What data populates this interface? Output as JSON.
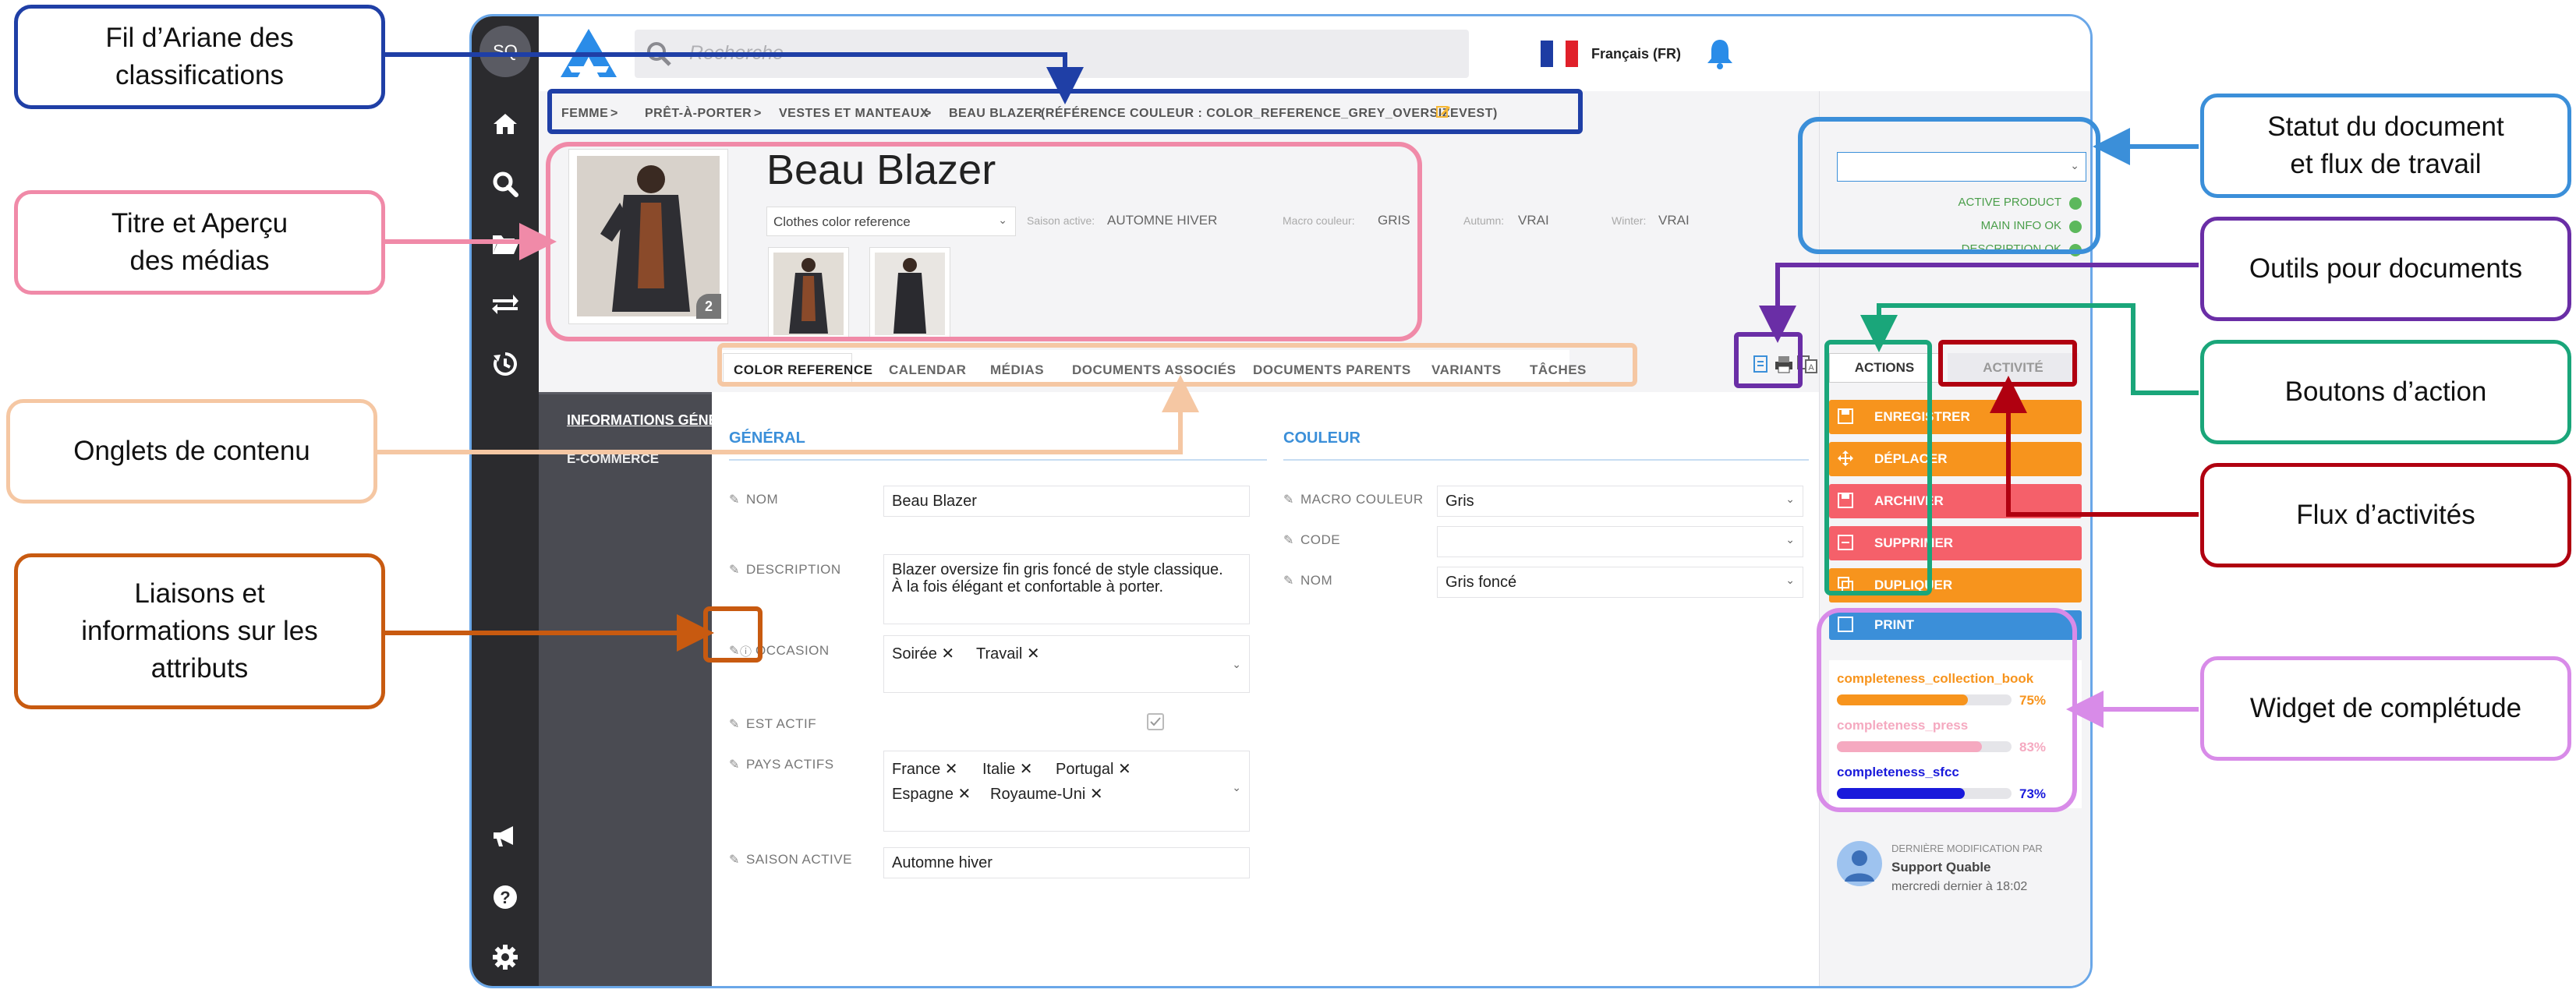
{
  "app": {
    "user_initials": "SQ",
    "search_placeholder": "Recherche",
    "language": "Français (FR)"
  },
  "breadcrumb": [
    "FEMME",
    "PRÊT-À-PORTER",
    "VESTES ET MANTEAUX",
    "BEAU BLAZER",
    "(RÉFÉRENCE COULEUR : COLOR_REFERENCE_GREY_OVERSIZEVEST)"
  ],
  "breadcrumb_sep": ">",
  "header": {
    "title": "Beau Blazer",
    "type_select": "Clothes color reference",
    "media_count": "2",
    "meta": [
      {
        "label": "Saison active:",
        "value": "AUTOMNE HIVER"
      },
      {
        "label": "Macro couleur:",
        "value": "GRIS"
      },
      {
        "label": "Autumn:",
        "value": "VRAI"
      },
      {
        "label": "Winter:",
        "value": "VRAI"
      }
    ]
  },
  "tabs": [
    "COLOR REFERENCE",
    "CALENDAR",
    "MÉDIAS",
    "DOCUMENTS ASSOCIÉS",
    "DOCUMENTS PARENTS",
    "VARIANTS",
    "TÂCHES"
  ],
  "left_nav": [
    "INFORMATIONS GÉNÉ",
    "E-COMMERCE"
  ],
  "general": {
    "heading": "GÉNÉRAL",
    "nom_label": "NOM",
    "nom_value": "Beau Blazer",
    "description_label": "DESCRIPTION",
    "description_value_1": "Blazer oversize fin gris foncé de style classique.",
    "description_value_2": "À la fois élégant et confortable à porter.",
    "occasion_label": "OCCASION",
    "occasion_values": [
      "Soirée",
      "Travail"
    ],
    "est_actif_label": "EST ACTIF",
    "pays_label": "PAYS ACTIFS",
    "pays_values": [
      "France",
      "Italie",
      "Portugal",
      "Espagne",
      "Royaume-Uni"
    ],
    "saison_label": "SAISON ACTIVE",
    "saison_value": "Automne hiver"
  },
  "couleur": {
    "heading": "COULEUR",
    "macro_label": "MACRO COULEUR",
    "macro_value": "Gris",
    "code_label": "CODE",
    "code_value": "",
    "nom_label": "NOM",
    "nom_value": "Gris foncé"
  },
  "status": [
    "ACTIVE PRODUCT",
    "MAIN INFO OK",
    "DESCRIPTION OK"
  ],
  "right_tabs": [
    "ACTIONS",
    "ACTIVITÉ"
  ],
  "actions": [
    {
      "label": "ENREGISTRER",
      "color": "#f7941d"
    },
    {
      "label": "DÉPLACER",
      "color": "#f7941d"
    },
    {
      "label": "ARCHIVER",
      "color": "#f5606a"
    },
    {
      "label": "SUPPRIMER",
      "color": "#f5606a"
    },
    {
      "label": "DUPLIQUER",
      "color": "#f7941d"
    },
    {
      "label": "PRINT",
      "color": "#3b8fd9"
    }
  ],
  "completeness": [
    {
      "label": "completeness_collection_book",
      "pct": "75%",
      "value": 0.75,
      "color": "#f7941d"
    },
    {
      "label": "completeness_press",
      "pct": "83%",
      "value": 0.83,
      "color": "#f5a9c0"
    },
    {
      "label": "completeness_sfcc",
      "pct": "73%",
      "value": 0.73,
      "color": "#1a1adb"
    }
  ],
  "last_modified": {
    "label": "DERNIÈRE MODIFICATION PAR",
    "user": "Support Quable",
    "date": "mercredi dernier à 18:02"
  },
  "callouts": {
    "breadcrumb": [
      "Fil d’Ariane des",
      "classifications"
    ],
    "title": [
      "Titre et Aperçu",
      "des médias"
    ],
    "tabs": [
      "Onglets de contenu"
    ],
    "links": [
      "Liaisons et",
      "informations sur les",
      "attributs"
    ],
    "status": [
      "Statut du document",
      "et flux de travail"
    ],
    "tools": [
      "Outils pour documents"
    ],
    "actions": [
      "Boutons d’action"
    ],
    "activity": [
      "Flux d’activités"
    ],
    "completeness": [
      "Widget de complétude"
    ]
  },
  "colors": {
    "breadcrumb": "#1f3fa6",
    "title": "#f08aa8",
    "tabs": "#f5c7a3",
    "links": "#c85a10",
    "status": "#3b8fd9",
    "tools": "#6a2ea6",
    "actions": "#1aa67a",
    "activity": "#b00010",
    "completeness": "#d88be8"
  }
}
